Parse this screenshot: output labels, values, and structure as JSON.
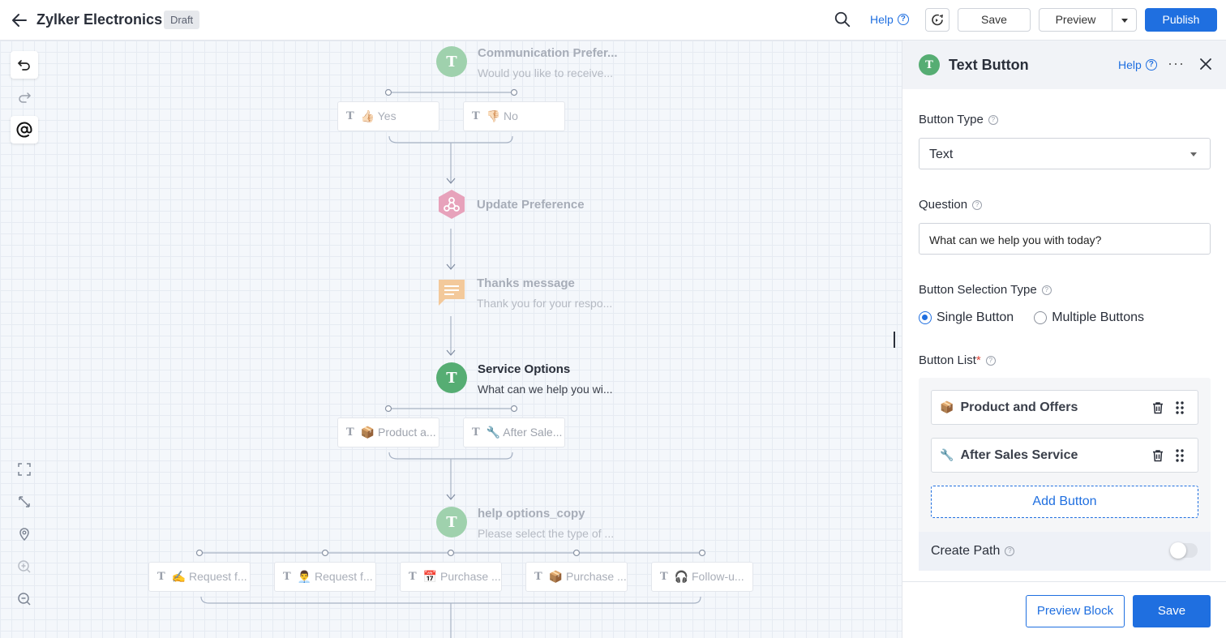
{
  "header": {
    "title": "Zylker Electronics",
    "status_badge": "Draft",
    "help_label": "Help",
    "save_label": "Save",
    "preview_label": "Preview",
    "publish_label": "Publish",
    "accent_color": "#1f6fe0"
  },
  "canvas": {
    "nodes": [
      {
        "title": "Communication Prefer...",
        "subtitle": "Would you like to receive...",
        "icon": "text-button-icon",
        "color": "#9fd1ad"
      },
      {
        "title": "Update Preference",
        "subtitle": "",
        "icon": "webhook-icon",
        "color": "#e7a2bb"
      },
      {
        "title": "Thanks message",
        "subtitle": "Thank you for your respo...",
        "icon": "message-icon",
        "color": "#f3c99b"
      },
      {
        "title": "Service Options",
        "subtitle": "What can we help you wi...",
        "icon": "text-button-icon",
        "color": "#56ad73"
      },
      {
        "title": "help options_copy",
        "subtitle": "Please select the type of ...",
        "icon": "text-button-icon",
        "color": "#9fd1ad"
      }
    ],
    "node_letter": "T",
    "chips_comm": [
      "👍🏻 Yes",
      "👎🏻 No"
    ],
    "chips_service": [
      "📦 Product a...",
      "🔧 After Sale..."
    ],
    "chips_help": [
      "✍️ Request f...",
      "👨‍💼 Request f...",
      "📅 Purchase ...",
      "📦 Purchase ...",
      "🎧 Follow-u..."
    ]
  },
  "panel": {
    "title": "Text Button",
    "help_label": "Help",
    "button_type_label": "Button Type",
    "button_type_value": "Text",
    "question_label": "Question",
    "question_value": "What can we help you with today?",
    "selection_type_label": "Button Selection Type",
    "selection_options": [
      "Single Button",
      "Multiple Buttons"
    ],
    "selected_option": "Single Button",
    "button_list_label": "Button List",
    "required_mark": "*",
    "buttons": [
      {
        "emoji": "📦",
        "label": "Product and Offers"
      },
      {
        "emoji": "🔧",
        "label": "After Sales Service"
      }
    ],
    "add_button_label": "Add Button",
    "create_path_label": "Create Path",
    "create_path_enabled": false,
    "preview_block_label": "Preview Block",
    "save_label": "Save"
  }
}
